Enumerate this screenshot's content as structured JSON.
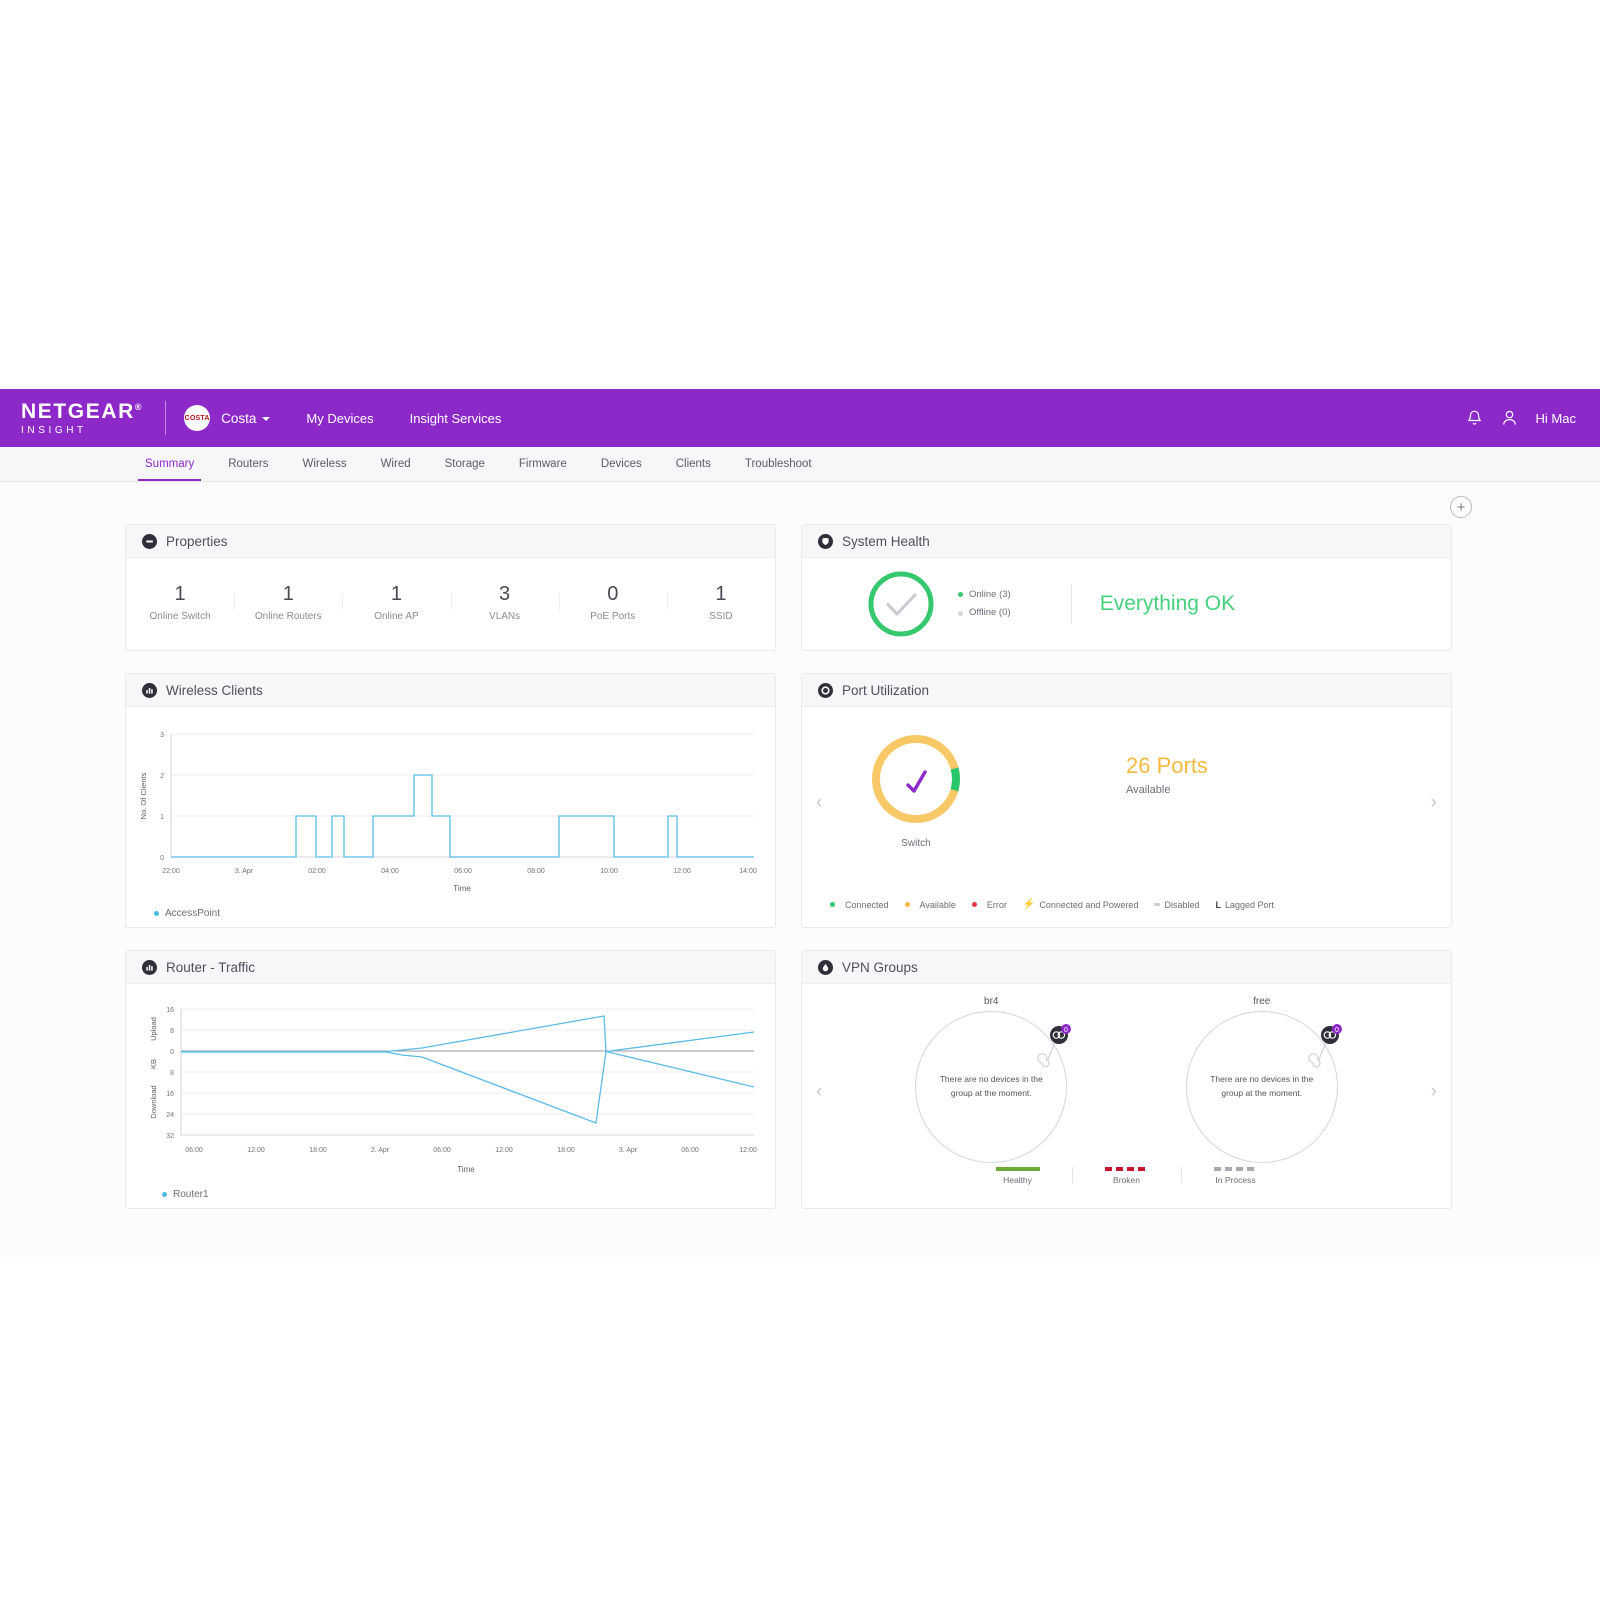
{
  "brand": {
    "name": "NETGEAR",
    "sub": "INSIGHT",
    "reg": "®"
  },
  "topbar": {
    "org_badge": "COSTA",
    "org_name": "Costa",
    "links": [
      {
        "label": "My Devices"
      },
      {
        "label": "Insight Services"
      }
    ],
    "bell_icon": "bell-icon",
    "user_icon": "user-icon",
    "greeting": "Hi Mac"
  },
  "tabs": [
    {
      "label": "Summary",
      "active": true
    },
    {
      "label": "Routers",
      "active": false
    },
    {
      "label": "Wireless",
      "active": false
    },
    {
      "label": "Wired",
      "active": false
    },
    {
      "label": "Storage",
      "active": false
    },
    {
      "label": "Firmware",
      "active": false
    },
    {
      "label": "Devices",
      "active": false
    },
    {
      "label": "Clients",
      "active": false
    },
    {
      "label": "Troubleshoot",
      "active": false
    }
  ],
  "toolbar": {
    "add_widget_label": "+"
  },
  "properties": {
    "title": "Properties",
    "stats": [
      {
        "value": "1",
        "label": "Online Switch"
      },
      {
        "value": "1",
        "label": "Online Routers"
      },
      {
        "value": "1",
        "label": "Online AP"
      },
      {
        "value": "3",
        "label": "VLANs"
      },
      {
        "value": "0",
        "label": "PoE Ports"
      },
      {
        "value": "1",
        "label": "SSID"
      }
    ]
  },
  "system_health": {
    "title": "System Health",
    "online_label": "Online (3)",
    "offline_label": "Offline (0)",
    "status_message": "Everything OK",
    "online_color": "#35c86e",
    "offline_color": "#d6d6dd",
    "online_count": 3,
    "offline_count": 0
  },
  "wireless_clients": {
    "title": "Wireless Clients",
    "legend": "AccessPoint",
    "legend_color": "#4db8e8"
  },
  "port_utilization": {
    "title": "Port Utilization",
    "device_label": "Switch",
    "count": "26 Ports",
    "count_sub": "Available",
    "count_color": "#f5b942",
    "legend": [
      {
        "label": "Connected",
        "color": "#35c86e",
        "glyph": "dot"
      },
      {
        "label": "Available",
        "color": "#f5b942",
        "glyph": "dot"
      },
      {
        "label": "Error",
        "color": "#e8354a",
        "glyph": "dot"
      },
      {
        "label": "Connected and Powered",
        "color": "#8e29c9",
        "glyph": "bolt"
      },
      {
        "label": "Disabled",
        "color": "#cfcfd6",
        "glyph": "square"
      },
      {
        "label": "Lagged Port",
        "color": "#55555f",
        "glyph": "L"
      }
    ]
  },
  "router_traffic": {
    "title": "Router - Traffic",
    "legend": "Router1",
    "legend_color": "#4db8e8"
  },
  "vpn_groups": {
    "title": "VPN Groups",
    "groups": [
      {
        "name": "br4",
        "empty_text": "There are no devices in the group at the moment."
      },
      {
        "name": "free",
        "empty_text": "There are no devices in the group at the moment."
      }
    ],
    "legend": [
      {
        "label": "Healthy",
        "color": "#6aab34",
        "style": "solid"
      },
      {
        "label": "Broken",
        "color": "#c4172c",
        "style": "dashed"
      },
      {
        "label": "In Process",
        "color": "#a8a8b0",
        "style": "dashed"
      }
    ]
  },
  "chart_data": [
    {
      "type": "line",
      "title": "Wireless Clients",
      "xlabel": "Time",
      "ylabel": "No. Of Clients",
      "ylim": [
        0,
        3
      ],
      "yticks": [
        0,
        1,
        2,
        3
      ],
      "xticks": [
        "22:00",
        "3. Apr",
        "02:00",
        "04:00",
        "06:00",
        "08:00",
        "10:00",
        "12:00",
        "14:00"
      ],
      "legend": [
        "AccessPoint"
      ],
      "legend_position": "bottom-left",
      "grid": true,
      "series": [
        {
          "name": "AccessPoint",
          "color": "#4db8e8",
          "points": [
            [
              0.0,
              0
            ],
            [
              21.5,
              0
            ],
            [
              21.5,
              1
            ],
            [
              25.0,
              1
            ],
            [
              25.0,
              0
            ],
            [
              27.5,
              0
            ],
            [
              27.5,
              1
            ],
            [
              29.5,
              1
            ],
            [
              29.5,
              0
            ],
            [
              34.5,
              0
            ],
            [
              34.5,
              1
            ],
            [
              41.5,
              1
            ],
            [
              41.5,
              2
            ],
            [
              44.5,
              2
            ],
            [
              44.5,
              1
            ],
            [
              47.5,
              1
            ],
            [
              47.5,
              0
            ],
            [
              66.5,
              0
            ],
            [
              66.5,
              1
            ],
            [
              76.0,
              1
            ],
            [
              76.0,
              0
            ],
            [
              85.5,
              0
            ],
            [
              85.5,
              1
            ],
            [
              87.0,
              1
            ],
            [
              87.0,
              0
            ],
            [
              100,
              0
            ]
          ]
        }
      ]
    },
    {
      "type": "line",
      "title": "Router - Traffic",
      "xlabel": "Time",
      "ylabel_top": "Upload KB",
      "ylabel_bottom": "Download KB",
      "ylim": [
        -32,
        16
      ],
      "yticks": [
        16,
        8,
        0,
        8,
        16,
        24,
        32
      ],
      "xticks": [
        "06:00",
        "12:00",
        "18:00",
        "2. Apr",
        "06:00",
        "12:00",
        "18:00",
        "3. Apr",
        "06:00",
        "12:00"
      ],
      "legend": [
        "Router1"
      ],
      "legend_position": "bottom-left",
      "grid": true,
      "series": [
        {
          "name": "Router1 upload",
          "color": "#4db8e8",
          "points": [
            [
              0,
              0
            ],
            [
              38,
              0
            ],
            [
              42,
              0.5
            ],
            [
              78,
              13
            ],
            [
              78.5,
              0
            ],
            [
              100,
              6
            ]
          ]
        },
        {
          "name": "Router1 download",
          "color": "#4db8e8",
          "points": [
            [
              0,
              0
            ],
            [
              38,
              0
            ],
            [
              42,
              -2
            ],
            [
              78,
              -25
            ],
            [
              78.5,
              0
            ],
            [
              100,
              -13
            ]
          ]
        }
      ]
    },
    {
      "type": "pie",
      "title": "System Health",
      "labels": [
        "Online",
        "Offline"
      ],
      "values": [
        3,
        0
      ],
      "colors": [
        "#35c86e",
        "#d6d6dd"
      ]
    },
    {
      "type": "pie",
      "title": "Port Utilization - Switch",
      "labels": [
        "Connected",
        "Available"
      ],
      "values": [
        2,
        26
      ],
      "colors": [
        "#35c86e",
        "#f5b942"
      ]
    }
  ]
}
